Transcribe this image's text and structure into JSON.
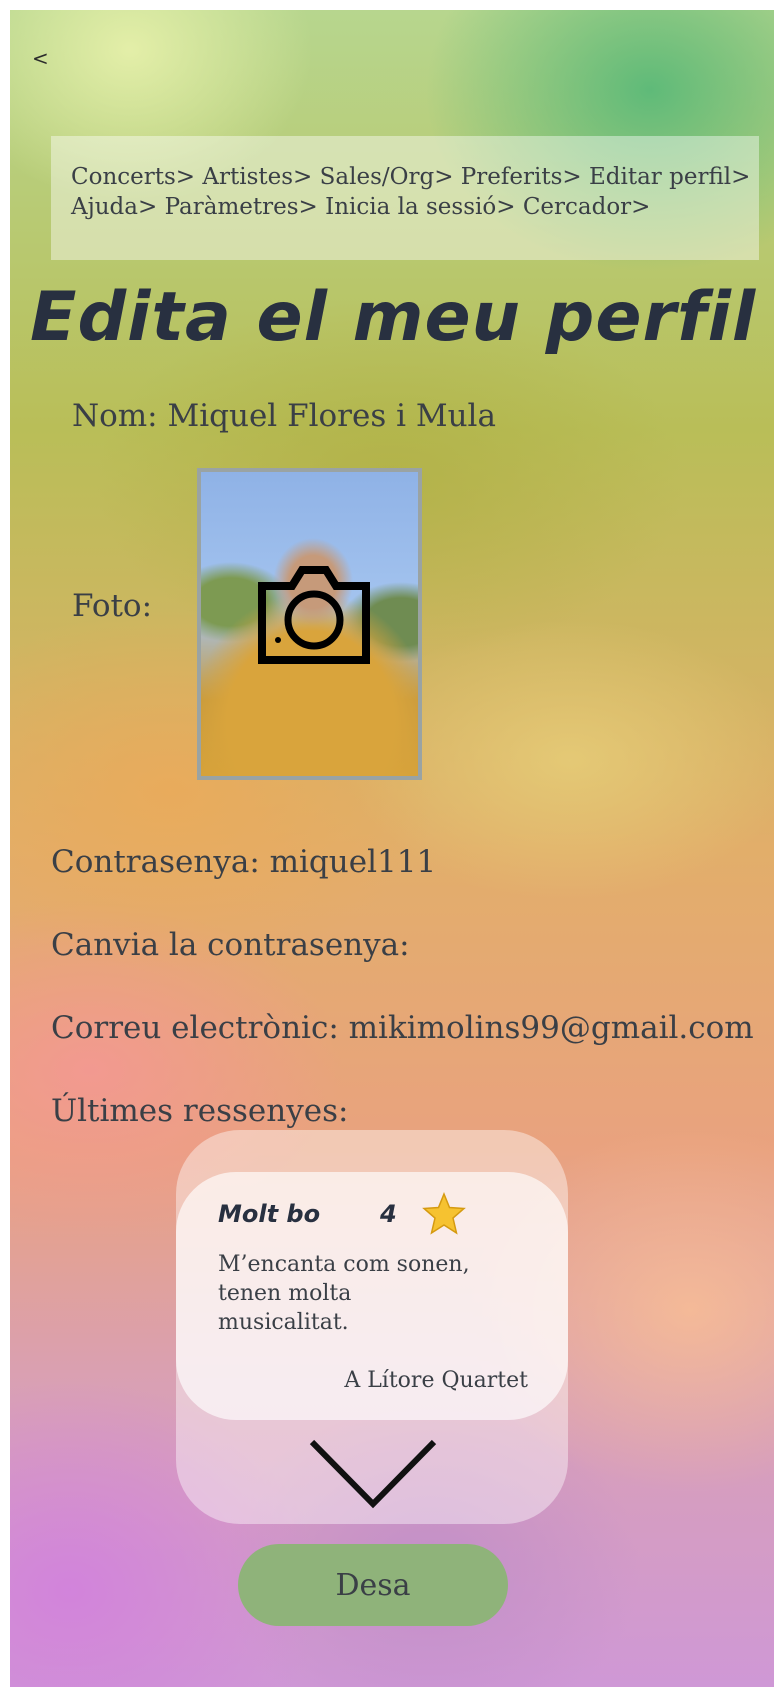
{
  "header": {
    "back_label": "<"
  },
  "nav": {
    "rows": [
      [
        "Concerts>",
        "Artistes>",
        "Sales/Org>",
        "Preferits>",
        "Editar perfil>"
      ],
      [
        "Ajuda>",
        "Paràmetres>",
        "Inicia la sessió>",
        "Cercador>"
      ]
    ]
  },
  "page": {
    "title": "Edita el meu perfil"
  },
  "profile": {
    "name_field": "Nom: Miquel Flores i Mula",
    "photo_label": "Foto:",
    "password_field": "Contrasenya: miquel111",
    "change_password_label": "Canvia la contrasenya:",
    "email_field": "Correu electrònic: mikimolins99@gmail.com",
    "reviews_label": "Últimes ressenyes:"
  },
  "review": {
    "title": "Molt bo",
    "rating": "4",
    "star_color": "#f6c230",
    "text": "M’encanta com sonen, tenen molta musicalitat.",
    "artist": "A Lítore Quartet"
  },
  "icons": {
    "photo_overlay": "camera-icon",
    "expand": "chevron-down-icon",
    "rating": "star-icon"
  },
  "actions": {
    "save_label": "Desa"
  },
  "colors": {
    "title": "#283040",
    "save_button": "#8fb37a",
    "text": "#3a3f46"
  }
}
